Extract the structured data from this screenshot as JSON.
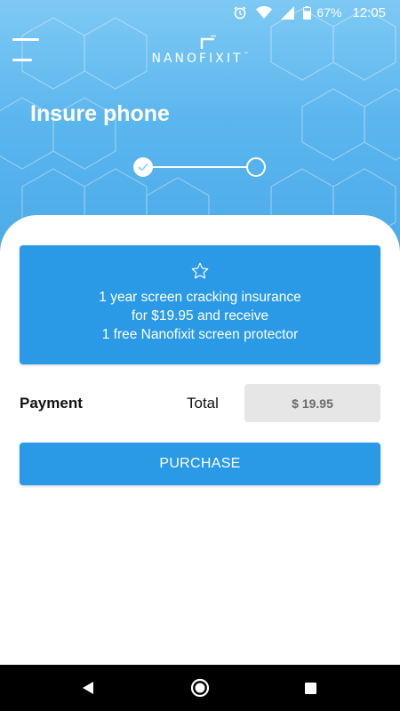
{
  "status_bar": {
    "battery_percent": "67%",
    "time": "12:05",
    "icons": [
      "alarm-icon",
      "wifi-icon",
      "signal-icon",
      "battery-icon"
    ]
  },
  "header": {
    "menu_icon": "hamburger-menu-icon",
    "logo_text": "NANOFIXIT",
    "logo_tm": "™",
    "title": "Insure phone"
  },
  "stepper": {
    "steps_total": 2,
    "current_step": 1,
    "completed_icon": "check-icon"
  },
  "offer": {
    "icon": "star-icon",
    "lines": [
      "1 year screen cracking insurance",
      "for $19.95 and receive",
      "1 free Nanofixit screen protector"
    ]
  },
  "payment": {
    "label": "Payment",
    "total_label": "Total",
    "total_value": "$ 19.95"
  },
  "purchase_button": {
    "label": "PURCHASE"
  },
  "navbar": {
    "icons": [
      "back-icon",
      "home-icon",
      "recents-icon"
    ]
  },
  "colors": {
    "accent": "#2a9ae6",
    "hero_top": "#7ec9f4",
    "hero_bottom": "#4aa9e8",
    "total_box": "#e6e6e6"
  }
}
